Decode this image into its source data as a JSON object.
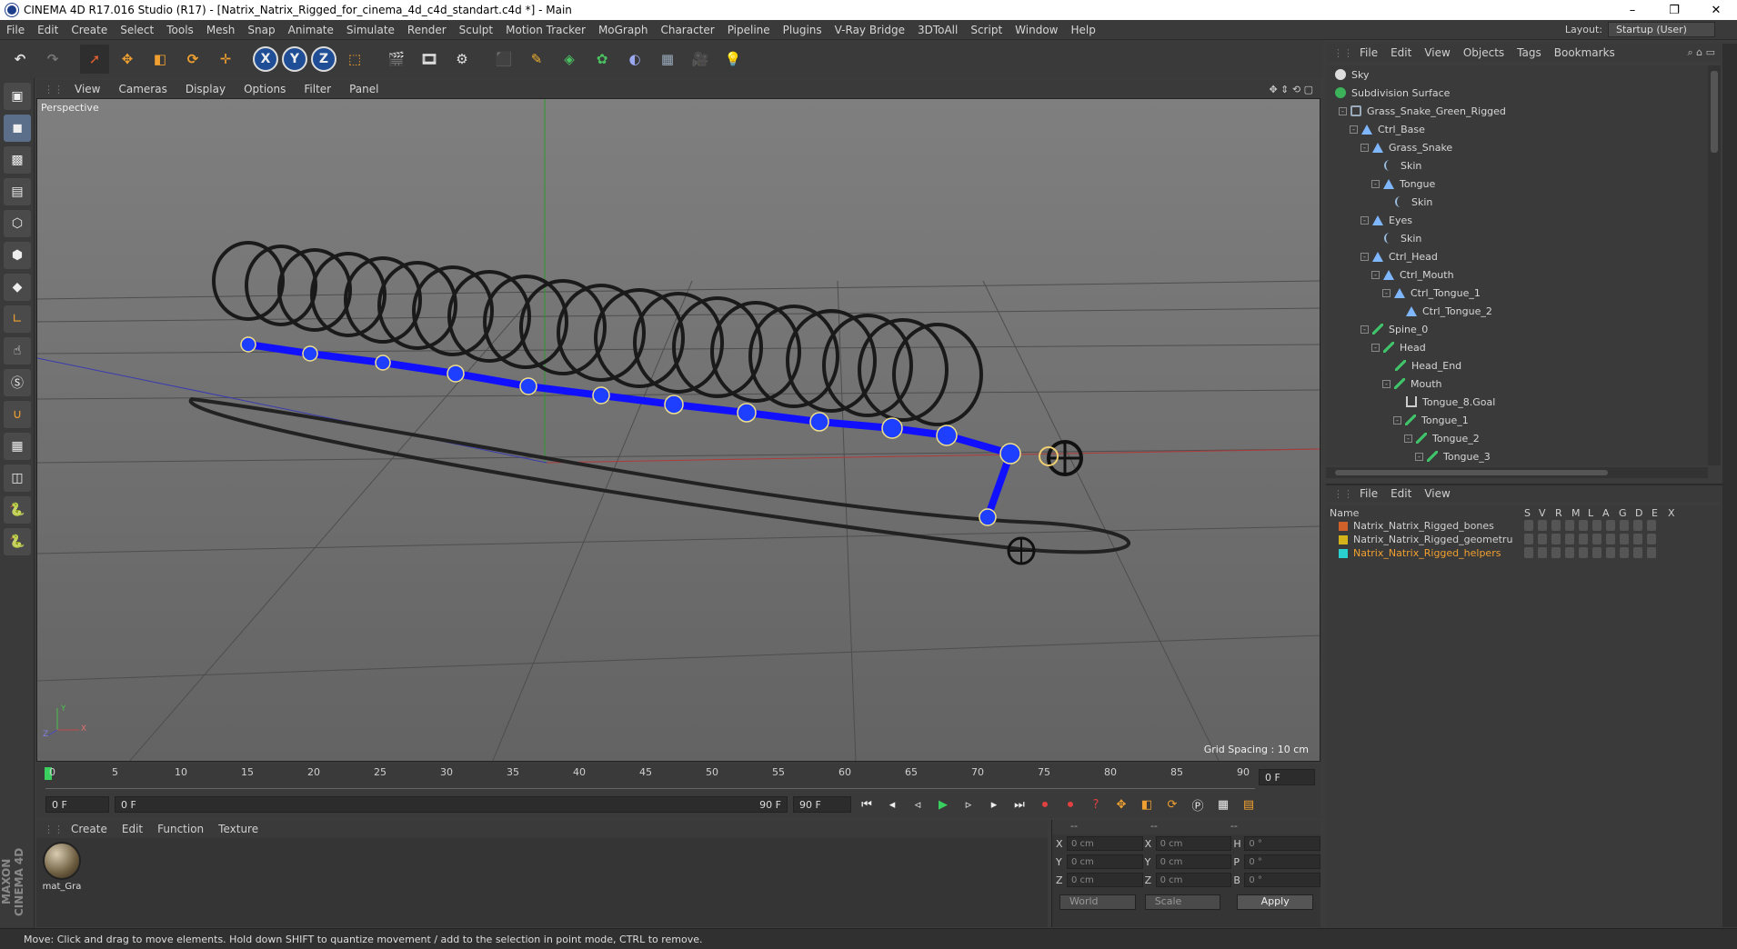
{
  "window": {
    "title": "CINEMA 4D R17.016 Studio (R17) - [Natrix_Natrix_Rigged_for_cinema_4d_c4d_standart.c4d *] - Main",
    "controls": [
      "–",
      "❐",
      "✕"
    ]
  },
  "menubar": {
    "items": [
      "File",
      "Edit",
      "Create",
      "Select",
      "Tools",
      "Mesh",
      "Snap",
      "Animate",
      "Simulate",
      "Render",
      "Sculpt",
      "Motion Tracker",
      "MoGraph",
      "Character",
      "Pipeline",
      "Plugins",
      "V-Ray Bridge",
      "3DToAll",
      "Script",
      "Window",
      "Help"
    ],
    "layout_label": "Layout:",
    "layout_value": "Startup (User)"
  },
  "toolbar": {
    "axis_labels": [
      "X",
      "Y",
      "Z"
    ]
  },
  "viewport": {
    "menu": [
      "View",
      "Cameras",
      "Display",
      "Options",
      "Filter",
      "Panel"
    ],
    "camera_label": "Perspective",
    "grid_spacing": "Grid Spacing : 10 cm",
    "axis_y": "Y",
    "axis_z": "Z",
    "axis_x": "X"
  },
  "timeline": {
    "ticks": [
      "0",
      "5",
      "10",
      "15",
      "20",
      "25",
      "30",
      "35",
      "40",
      "45",
      "50",
      "55",
      "60",
      "65",
      "70",
      "75",
      "80",
      "85",
      "90"
    ],
    "current_frame": "0 F"
  },
  "time_controls": {
    "start_field": "0 F",
    "range_left": "0 F",
    "range_right": "90 F",
    "end_field": "90 F"
  },
  "material_manager": {
    "menu": [
      "Create",
      "Edit",
      "Function",
      "Texture"
    ],
    "materials": [
      {
        "name": "mat_Gra"
      }
    ]
  },
  "coordinates": {
    "headers": [
      "--",
      "--",
      "--"
    ],
    "rows": [
      {
        "a": "X",
        "av": "0 cm",
        "b": "X",
        "bv": "0 cm",
        "c": "H",
        "cv": "0 °"
      },
      {
        "a": "Y",
        "av": "0 cm",
        "b": "Y",
        "bv": "0 cm",
        "c": "P",
        "cv": "0 °"
      },
      {
        "a": "Z",
        "av": "0 cm",
        "b": "Z",
        "bv": "0 cm",
        "c": "B",
        "cv": "0 °"
      }
    ],
    "space": "World",
    "mode": "Scale",
    "apply": "Apply"
  },
  "object_manager": {
    "menu": [
      "File",
      "Edit",
      "View",
      "Objects",
      "Tags",
      "Bookmarks"
    ],
    "items": [
      {
        "label": "Sky",
        "icon": "sky"
      },
      {
        "label": "Subdivision Surface",
        "icon": "sub"
      },
      {
        "label": "Grass_Snake_Green_Rigged",
        "icon": "null"
      },
      {
        "label": "Ctrl_Base",
        "icon": "joint"
      },
      {
        "label": "Grass_Snake",
        "icon": "joint"
      },
      {
        "label": "Skin",
        "icon": "skin"
      },
      {
        "label": "Tongue",
        "icon": "joint"
      },
      {
        "label": "Skin",
        "icon": "skin"
      },
      {
        "label": "Eyes",
        "icon": "joint"
      },
      {
        "label": "Skin",
        "icon": "skin"
      },
      {
        "label": "Ctrl_Head",
        "icon": "joint"
      },
      {
        "label": "Ctrl_Mouth",
        "icon": "joint"
      },
      {
        "label": "Ctrl_Tongue_1",
        "icon": "joint"
      },
      {
        "label": "Ctrl_Tongue_2",
        "icon": "joint"
      },
      {
        "label": "Spine_0",
        "icon": "bone"
      },
      {
        "label": "Head",
        "icon": "bone"
      },
      {
        "label": "Head_End",
        "icon": "bone"
      },
      {
        "label": "Mouth",
        "icon": "bone"
      },
      {
        "label": "Tongue_8.Goal",
        "icon": "goal"
      },
      {
        "label": "Tongue_1",
        "icon": "bone"
      },
      {
        "label": "Tongue_2",
        "icon": "bone"
      },
      {
        "label": "Tongue_3",
        "icon": "bone"
      }
    ]
  },
  "layer_manager": {
    "menu": [
      "File",
      "Edit",
      "View"
    ],
    "columns": [
      "Name",
      "S",
      "V",
      "R",
      "M",
      "L",
      "A",
      "G",
      "D",
      "E",
      "X"
    ],
    "layers": [
      {
        "name": "Natrix_Natrix_Rigged_bones",
        "color": "#d0612a"
      },
      {
        "name": "Natrix_Natrix_Rigged_geometru",
        "color": "#d4b21a"
      },
      {
        "name": "Natrix_Natrix_Rigged_helpers",
        "color": "#2ad0d0"
      }
    ]
  },
  "status_bar": {
    "text": "Move: Click and drag to move elements. Hold down SHIFT to quantize movement / add to the selection in point mode, CTRL to remove."
  },
  "branding": {
    "maxon": "MAXON CINEMA 4D"
  }
}
